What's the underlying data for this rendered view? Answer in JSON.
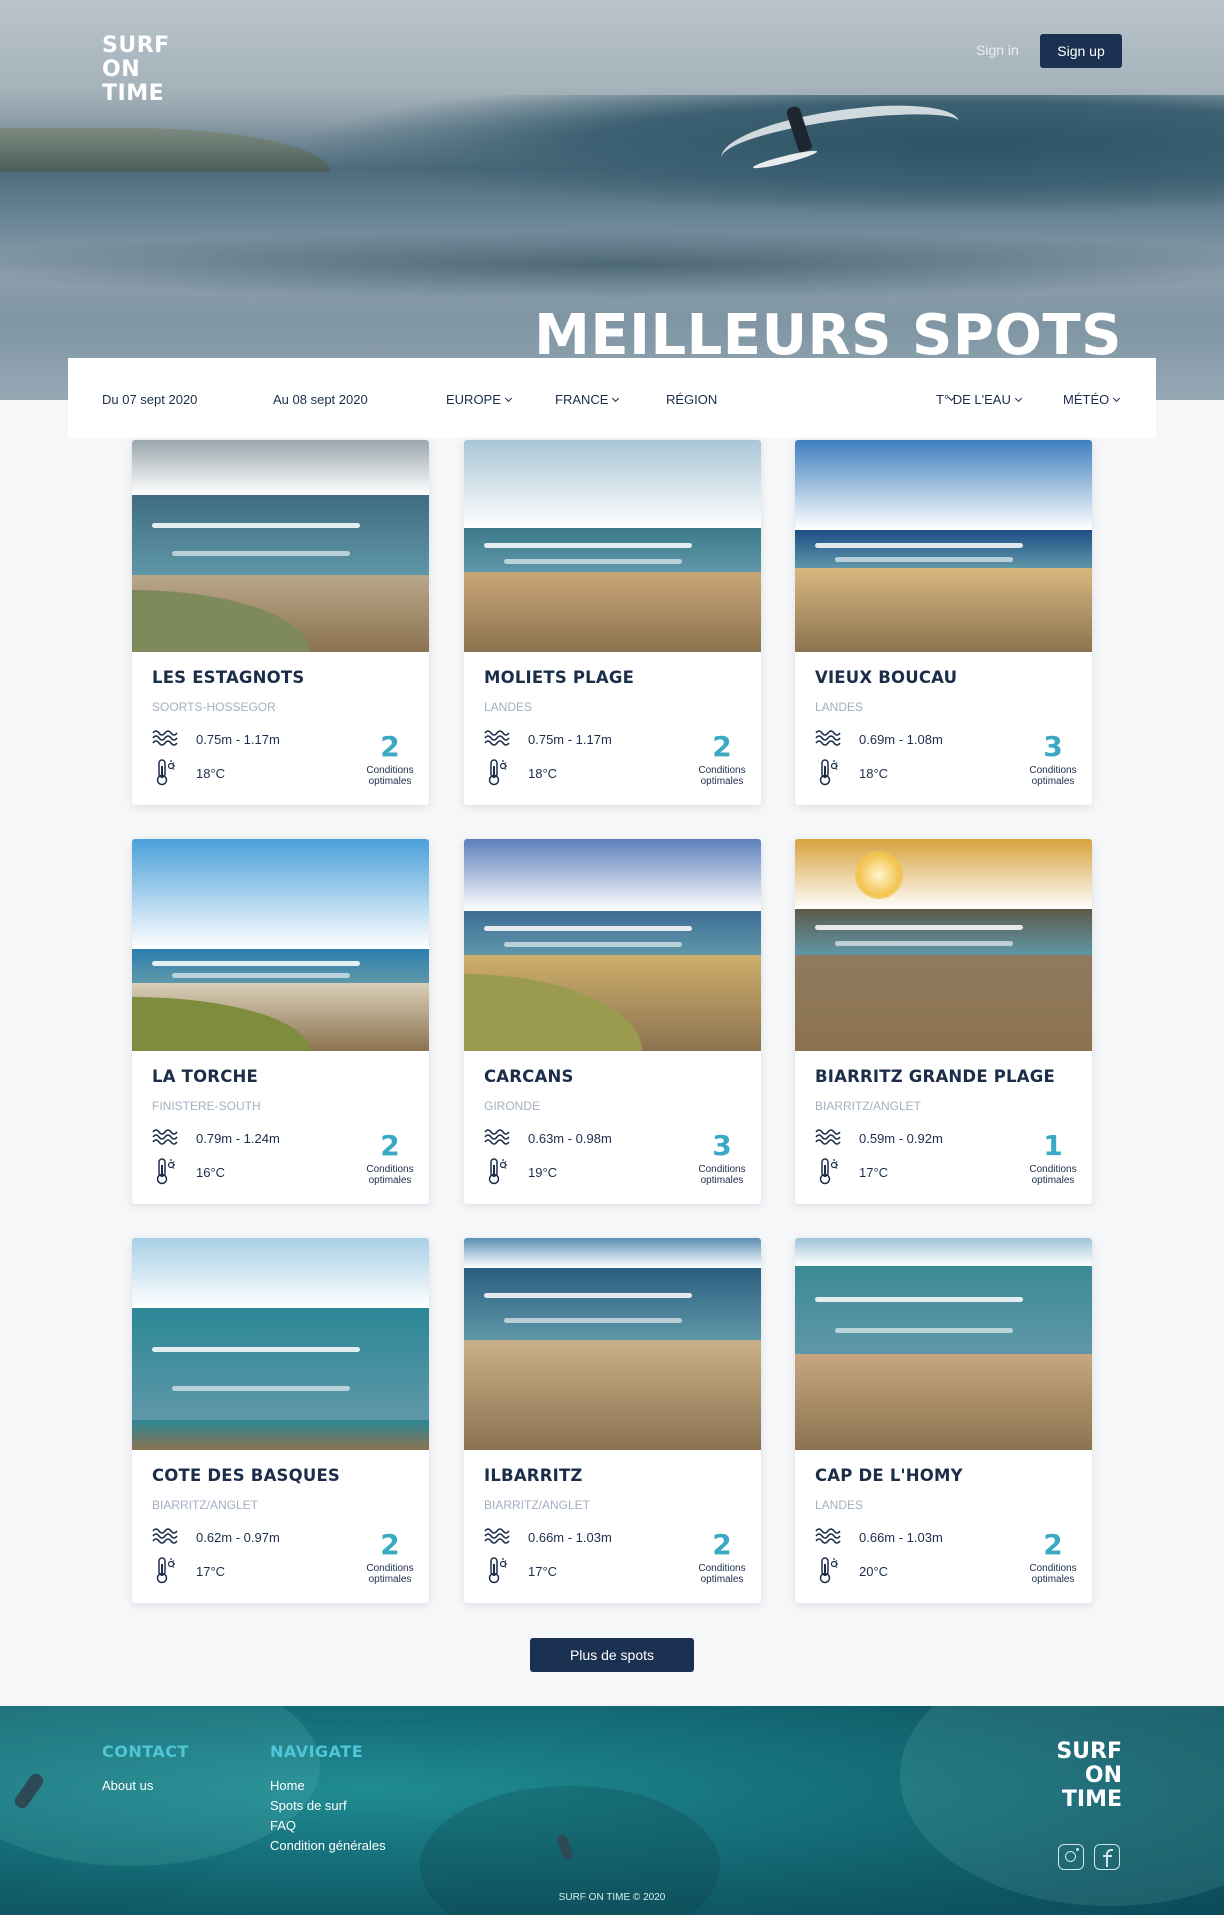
{
  "header": {
    "logo_lines": [
      "SURF",
      "ON",
      "TIME"
    ],
    "signin_label": "Sign in",
    "signup_label": "Sign up",
    "hero_title": "MEILLEURS SPOTS"
  },
  "filters": {
    "date_from": "Du 07 sept 2020",
    "date_to": "Au 08 sept 2020",
    "continent": "EUROPE",
    "country": "FRANCE",
    "region": "RÉGION",
    "water_temp": "T° DE L'EAU",
    "weather": "MÉTÉO"
  },
  "spots": [
    {
      "name": "LES ESTAGNOTS",
      "region": "SOORTS-HOSSEGOR",
      "height": "0.75m - 1.17m",
      "temp": "18°C",
      "score": "2",
      "cond_line1": "Conditions",
      "cond_line2": "optimales"
    },
    {
      "name": "MOLIETS PLAGE",
      "region": "LANDES",
      "height": "0.75m - 1.17m",
      "temp": "18°C",
      "score": "2",
      "cond_line1": "Conditions",
      "cond_line2": "optimales"
    },
    {
      "name": "VIEUX BOUCAU",
      "region": "LANDES",
      "height": "0.69m - 1.08m",
      "temp": "18°C",
      "score": "3",
      "cond_line1": "Conditions",
      "cond_line2": "optimales"
    },
    {
      "name": "LA TORCHE",
      "region": "FINISTERE-SOUTH",
      "height": "0.79m - 1.24m",
      "temp": "16°C",
      "score": "2",
      "cond_line1": "Conditions",
      "cond_line2": "optimales"
    },
    {
      "name": "CARCANS",
      "region": "GIRONDE",
      "height": "0.63m - 0.98m",
      "temp": "19°C",
      "score": "3",
      "cond_line1": "Conditions",
      "cond_line2": "optimales"
    },
    {
      "name": "BIARRITZ GRANDE PLAGE",
      "region": "BIARRITZ/ANGLET",
      "height": "0.59m - 0.92m",
      "temp": "17°C",
      "score": "1",
      "cond_line1": "Conditions",
      "cond_line2": "optimales"
    },
    {
      "name": "COTE DES BASQUES",
      "region": "BIARRITZ/ANGLET",
      "height": "0.62m - 0.97m",
      "temp": "17°C",
      "score": "2",
      "cond_line1": "Conditions",
      "cond_line2": "optimales"
    },
    {
      "name": "ILBARRITZ",
      "region": "BIARRITZ/ANGLET",
      "height": "0.66m - 1.03m",
      "temp": "17°C",
      "score": "2",
      "cond_line1": "Conditions",
      "cond_line2": "optimales"
    },
    {
      "name": "CAP DE L'HOMY",
      "region": "LANDES",
      "height": "0.66m - 1.03m",
      "temp": "20°C",
      "score": "2",
      "cond_line1": "Conditions",
      "cond_line2": "optimales"
    }
  ],
  "more_label": "Plus de spots",
  "footer": {
    "contact_title": "CONTACT",
    "contact_links": [
      "About us"
    ],
    "navigate_title": "NAVIGATE",
    "navigate_links": [
      "Home",
      "Spots de surf",
      "FAQ",
      "Condition générales"
    ],
    "logo_lines": [
      "SURF",
      "ON",
      "TIME"
    ],
    "social": [
      "instagram-icon",
      "facebook-icon"
    ],
    "copyright": "SURF ON TIME © 2020"
  },
  "colors": {
    "navy": "#1a3152",
    "accent": "#3aa9c4",
    "muted": "#a4b0c0",
    "footer_teal": "#16727c"
  }
}
